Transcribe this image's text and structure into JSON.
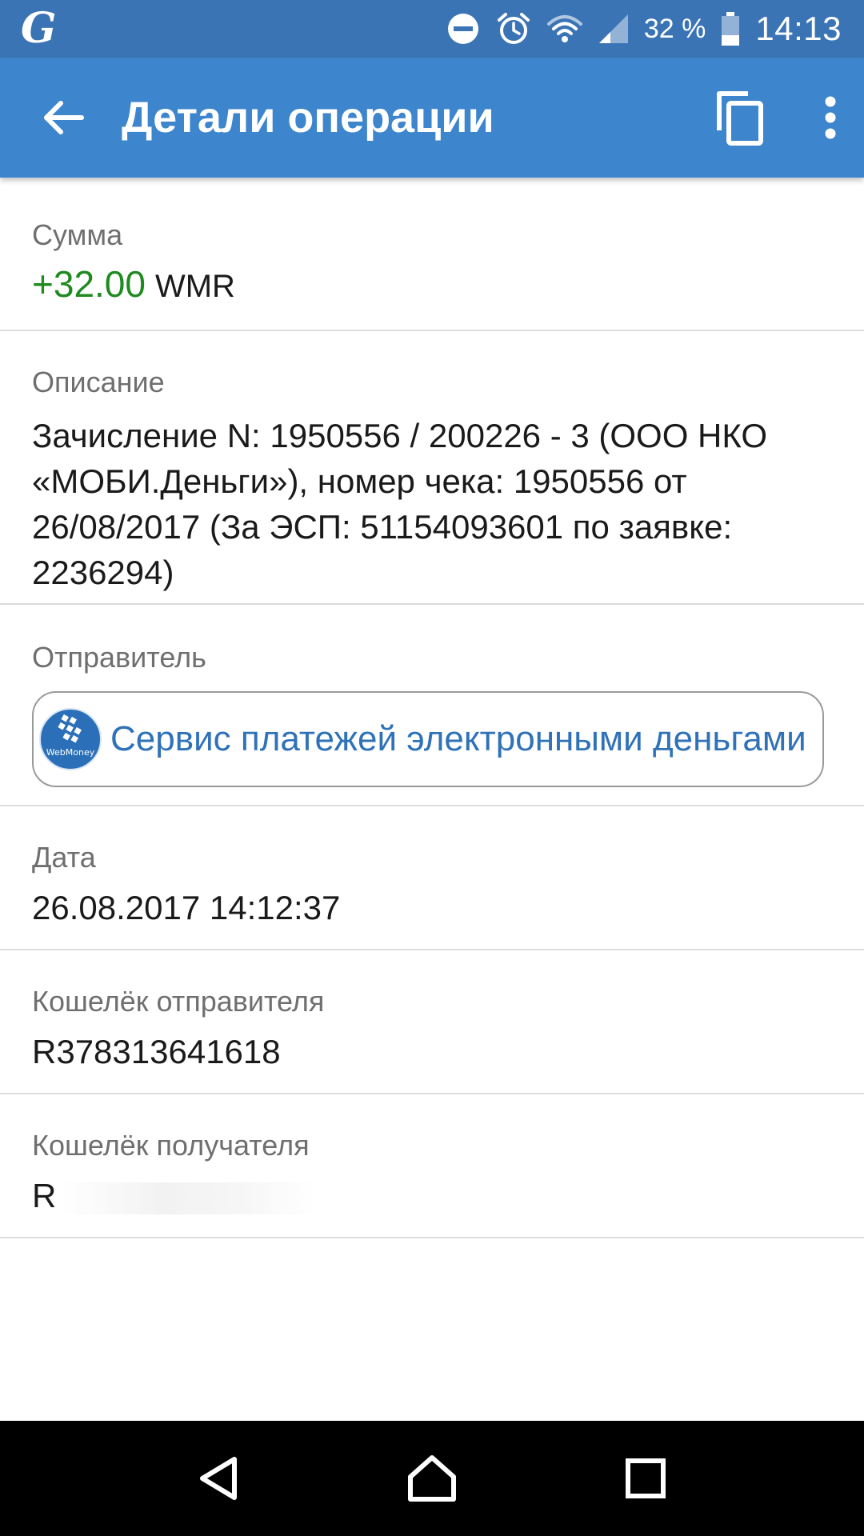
{
  "status_bar": {
    "app_icon": "G",
    "icons": [
      "dnd-icon",
      "alarm-icon",
      "wifi-icon",
      "signal-icon",
      "battery-icon"
    ],
    "battery": "32 %",
    "time": "14:13"
  },
  "app_bar": {
    "title": "Детали операции",
    "icons": [
      "back-arrow-icon",
      "copy-icon",
      "more-vert-icon"
    ]
  },
  "fields": {
    "amount": {
      "label": "Сумма",
      "value": "+32.00",
      "currency": "WMR",
      "value_color": "#1f8a1f"
    },
    "description": {
      "label": "Описание",
      "value": "Зачисление N: 1950556 / 200226 - 3 (ООО НКО «МОБИ.Деньги»), номер чека: 1950556 от 26/08/2017 (За ЭСП: 51154093601 по заявке: 2236294)"
    },
    "sender": {
      "label": "Отправитель",
      "name": "Сервис платежей электронными деньгами",
      "logo": "WebMoney",
      "name_color": "#2f72b8"
    },
    "date": {
      "label": "Дата",
      "value": "26.08.2017 14:12:37"
    },
    "wallet_from": {
      "label": "Кошелёк отправителя",
      "value": "R378313641618"
    },
    "wallet_to": {
      "label": "Кошелёк получателя",
      "value": "R"
    }
  },
  "nav_bar": {
    "icons": [
      "back-triangle-icon",
      "home-icon",
      "recents-icon"
    ]
  },
  "colors": {
    "status_bar": "#3a74b5",
    "app_bar": "#3d85cc",
    "accent_link": "#2f72b8",
    "positive": "#1f8a1f"
  }
}
